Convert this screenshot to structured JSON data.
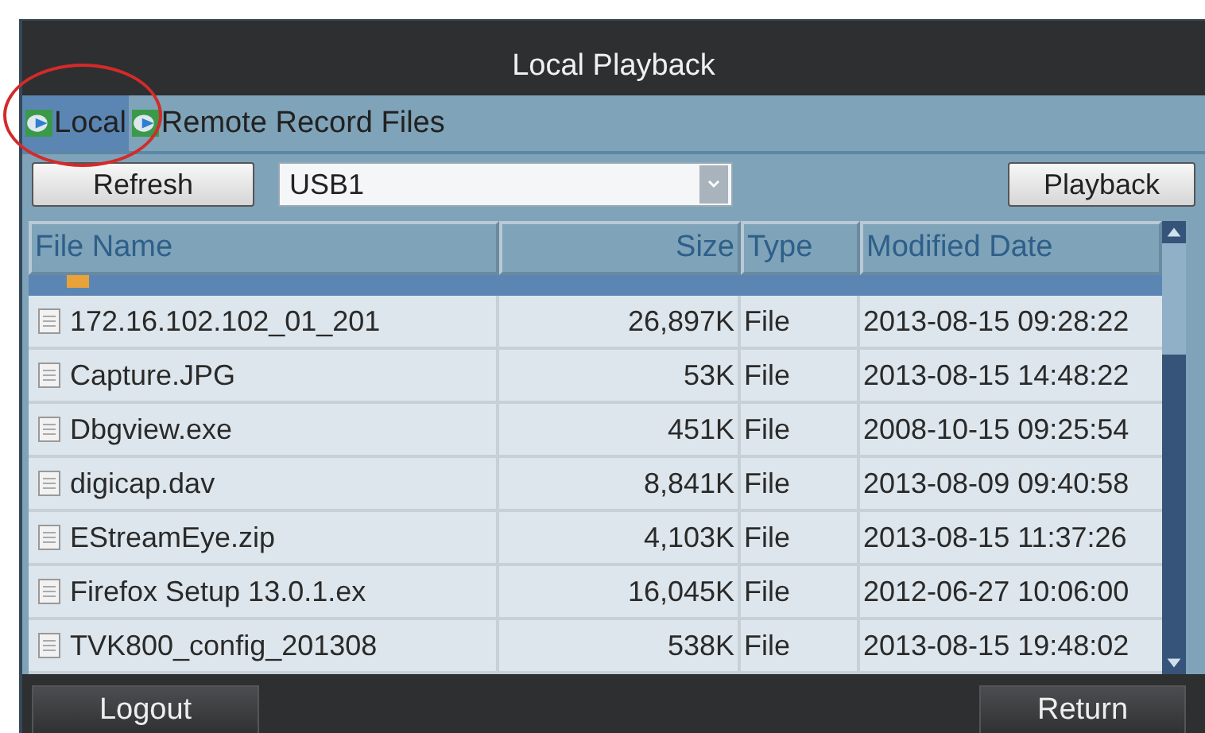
{
  "window": {
    "title": "Local Playback"
  },
  "tabs": [
    {
      "label": "Local",
      "selected": true
    },
    {
      "label": "Remote Record Files",
      "selected": false
    }
  ],
  "toolbar": {
    "refresh": "Refresh",
    "device": {
      "value": "USB1"
    },
    "playback": "Playback"
  },
  "table": {
    "columns": [
      {
        "label": "File Name"
      },
      {
        "label": "Size"
      },
      {
        "label": "Type"
      },
      {
        "label": "Modified Date"
      }
    ],
    "rows": [
      {
        "kind": "folder",
        "selected": true,
        "cells": []
      },
      {
        "kind": "file",
        "selected": false,
        "cells": [
          "172.16.102.102_01_201",
          "26,897K",
          "File",
          "2013-08-15 09:28:22"
        ]
      },
      {
        "kind": "file",
        "selected": false,
        "cells": [
          "Capture.JPG",
          "53K",
          "File",
          "2013-08-15 14:48:22"
        ]
      },
      {
        "kind": "file",
        "selected": false,
        "cells": [
          "Dbgview.exe",
          "451K",
          "File",
          "2008-10-15 09:25:54"
        ]
      },
      {
        "kind": "file",
        "selected": false,
        "cells": [
          "digicap.dav",
          "8,841K",
          "File",
          "2013-08-09 09:40:58"
        ]
      },
      {
        "kind": "file",
        "selected": false,
        "cells": [
          "EStreamEye.zip",
          "4,103K",
          "File",
          "2013-08-15 11:37:26"
        ]
      },
      {
        "kind": "file",
        "selected": false,
        "cells": [
          "Firefox Setup 13.0.1.ex",
          "16,045K",
          "File",
          "2012-06-27 10:06:00"
        ]
      },
      {
        "kind": "file",
        "selected": false,
        "cells": [
          "TVK800_config_201308",
          "538K",
          "File",
          "2013-08-15 19:48:02"
        ]
      }
    ]
  },
  "footer": {
    "buttons": [
      "Logout",
      "Return"
    ]
  }
}
